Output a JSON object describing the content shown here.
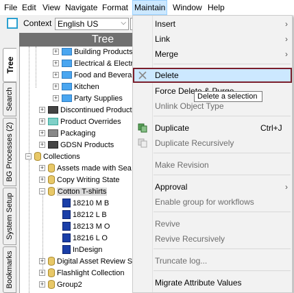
{
  "menubar": {
    "file": "File",
    "edit": "Edit",
    "view": "View",
    "navigate": "Navigate",
    "format": "Format",
    "maintain": "Maintain",
    "window": "Window",
    "help": "Help"
  },
  "toolbar": {
    "context_label": "Context",
    "context_value": "English US"
  },
  "vtabs": {
    "tree": "Tree",
    "search": "Search",
    "bg_processes": "BG Processes (2)",
    "system_setup": "System Setup",
    "bookmarks": "Bookmarks"
  },
  "tree": {
    "header": "Tree",
    "rows": [
      {
        "label": "Building Products"
      },
      {
        "label": "Electrical & Electr"
      },
      {
        "label": "Food and Bevera"
      },
      {
        "label": "Kitchen"
      },
      {
        "label": "Party Supplies"
      },
      {
        "label": "Discontinued Product"
      },
      {
        "label": "Product Overrides"
      },
      {
        "label": "Packaging"
      },
      {
        "label": "GDSN Products"
      },
      {
        "label": "Collections"
      },
      {
        "label": "Assets made with Sea"
      },
      {
        "label": "Copy Writing State"
      },
      {
        "label": "Cotton T-shirts"
      },
      {
        "label": "18210 M B"
      },
      {
        "label": "18212 L B"
      },
      {
        "label": "18213 M O"
      },
      {
        "label": "18216 L O"
      },
      {
        "label": "InDesign"
      },
      {
        "label": "Digital Asset Review S"
      },
      {
        "label": "Flashlight Collection"
      },
      {
        "label": "Group2"
      }
    ]
  },
  "menu": {
    "insert": "Insert",
    "link": "Link",
    "merge": "Merge",
    "delete": "Delete",
    "force_delete": "Force Delete & Purge",
    "unlink": "Unlink Object Type",
    "duplicate": "Duplicate",
    "duplicate_shortcut": "Ctrl+J",
    "duplicate_recursively": "Duplicate Recursively",
    "make_revision": "Make Revision",
    "approval": "Approval",
    "enable_group": "Enable group for workflows",
    "revive": "Revive",
    "revive_recursively": "Revive Recursively",
    "truncate_log": "Truncate log...",
    "migrate": "Migrate Attribute Values"
  },
  "tooltip": "Delete a selection",
  "colors": {
    "highlight": "#cce8ff",
    "focus_border": "#7a1d2a",
    "folder": "#4aa6f0"
  }
}
